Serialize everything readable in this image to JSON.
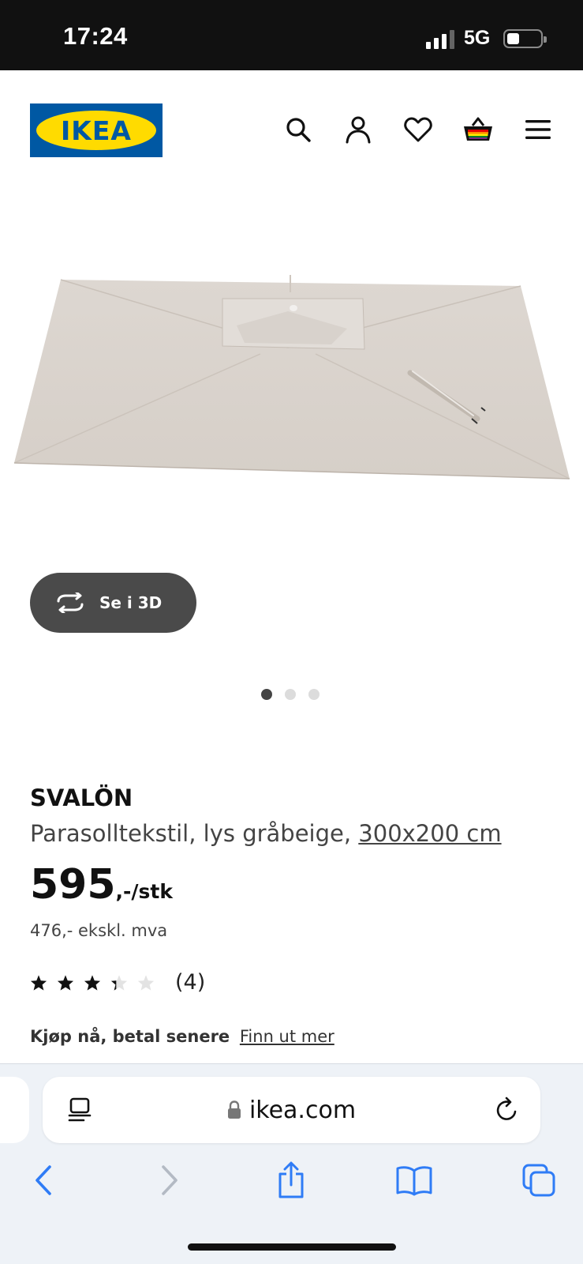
{
  "status_bar": {
    "time": "17:24",
    "network": "5G",
    "battery_level": 0.3
  },
  "header": {
    "logo_text": "IKEA",
    "icons": [
      "search-icon",
      "account-icon",
      "heart-icon",
      "basket-icon",
      "menu-icon"
    ]
  },
  "gallery": {
    "view_3d_label": "Se i 3D",
    "slide_count": 3,
    "active_slide": 1
  },
  "product": {
    "name": "SVALÖN",
    "description": "Parasolltekstil, lys gråbeige,",
    "size": "300x200 cm",
    "price": "595",
    "price_suffix": ",-/stk",
    "price_ex_vat": "476,- ekskl. mva",
    "rating": 3.5,
    "rating_max": 5,
    "review_count": "(4)",
    "bnpl_text": "Kjøp nå, betal senere",
    "bnpl_link": "Finn ut mer"
  },
  "browser": {
    "domain": "ikea.com",
    "toolbar": [
      "back-icon",
      "forward-icon",
      "share-icon",
      "bookmarks-icon",
      "tabs-icon"
    ]
  },
  "colors": {
    "ikea_blue": "#0058a3",
    "ikea_yellow": "#ffdb00",
    "safari_blue": "#2f7cf6",
    "button_dark": "#4a4a4a"
  }
}
